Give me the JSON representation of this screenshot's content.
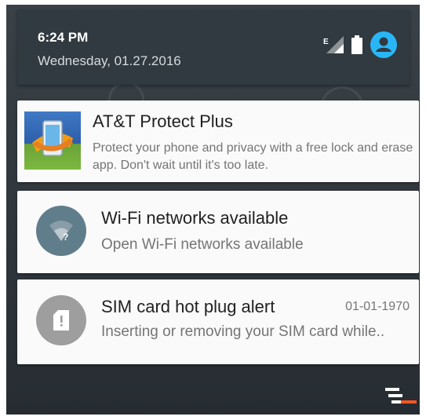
{
  "status_bar": {
    "time": "6:24 PM",
    "date": "Wednesday, 01.27.2016",
    "network_letter": "E",
    "icons": [
      "signal-icon",
      "battery-icon",
      "account-icon"
    ]
  },
  "notifications": [
    {
      "title": "AT&T Protect Plus",
      "body": "Protect your phone and privacy with a free lock and erase app. Don't wait until it's too late.",
      "icon": "att-protect-app-icon"
    },
    {
      "title": "Wi-Fi networks available",
      "body": "Open Wi-Fi networks available",
      "icon": "wifi-question-icon",
      "icon_color": "#607d8b"
    },
    {
      "title": "SIM card hot plug alert",
      "time": "01-01-1970",
      "body": "Inserting or removing your SIM card while..",
      "icon": "sim-alert-icon",
      "icon_color": "#9e9e9e"
    }
  ],
  "actions": {
    "clear_all_icon": "clear-all-icon"
  },
  "colors": {
    "accent": "#29b6f6",
    "clear_all_accent": "#ff5722",
    "shade_bg": "#313a40"
  }
}
